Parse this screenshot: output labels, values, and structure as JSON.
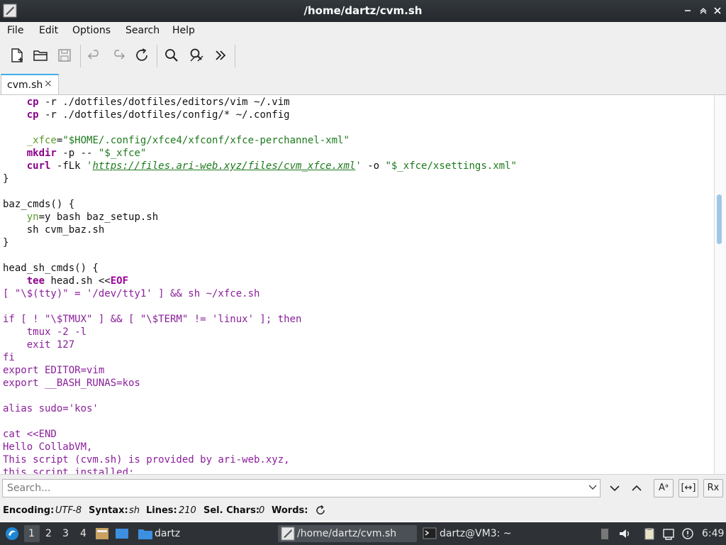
{
  "window": {
    "title": "/home/dartz/cvm.sh"
  },
  "menu": [
    "File",
    "Edit",
    "Options",
    "Search",
    "Help"
  ],
  "toolbar": {
    "icons": [
      "new-file-icon",
      "open-file-icon",
      "save-icon",
      "undo-icon",
      "redo-icon",
      "reload-icon",
      "find-icon",
      "replace-icon",
      "more-icon"
    ]
  },
  "tab": {
    "label": "cvm.sh",
    "close": "×"
  },
  "code_lines": [
    "    cp -r ./dotfiles/dotfiles/editors/vim ~/.vim",
    "    cp -r ./dotfiles/dotfiles/config/* ~/.config",
    "",
    "    _xfce=\"$HOME/.config/xfce4/xfconf/xfce-perchannel-xml\"",
    "    mkdir -p -- \"$_xfce\"",
    "    curl -fLk 'https://files.ari-web.xyz/files/cvm_xfce.xml' -o \"$_xfce/xsettings.xml\"",
    "}",
    "",
    "baz_cmds() {",
    "    yn=y bash baz_setup.sh",
    "    sh cvm_baz.sh",
    "}",
    "",
    "head_sh_cmds() {",
    "    tee head.sh <<EOF",
    "[ \"\\$(tty)\" = '/dev/tty1' ] && sh ~/xfce.sh",
    "",
    "if [ ! \"\\$TMUX\" ] && [ \"\\$TERM\" != 'linux' ]; then",
    "    tmux -2 -l",
    "    exit 127",
    "fi",
    "export EDITOR=vim",
    "export __BASH_RUNAS=kos",
    "",
    "alias sudo='kos'",
    "",
    "cat <<END",
    "Hello CollabVM,",
    "This script (cvm.sh) is provided by ari-web.xyz,",
    "this script installed:"
  ],
  "search": {
    "placeholder": "Search...",
    "case_btn": "Aᵃ",
    "whole_btn": "[↔]",
    "regex_btn": "Rx"
  },
  "status": {
    "encoding_label": "Encoding:",
    "encoding": "UTF-8",
    "syntax_label": "Syntax:",
    "syntax": "sh",
    "lines_label": "Lines:",
    "lines": "210",
    "sel_label": "Sel. Chars:",
    "sel": "0",
    "words_label": "Words:"
  },
  "panel": {
    "workspaces": [
      "1",
      "2",
      "3",
      "4"
    ],
    "folder_label": "dartz",
    "task1": "/home/dartz/cvm.sh",
    "task2": "dartz@VM3: ~",
    "clock": "6:49"
  },
  "colors": {
    "accent": "#3daee9",
    "panel": "#2e3236",
    "titlebar": "#2b2f33"
  }
}
